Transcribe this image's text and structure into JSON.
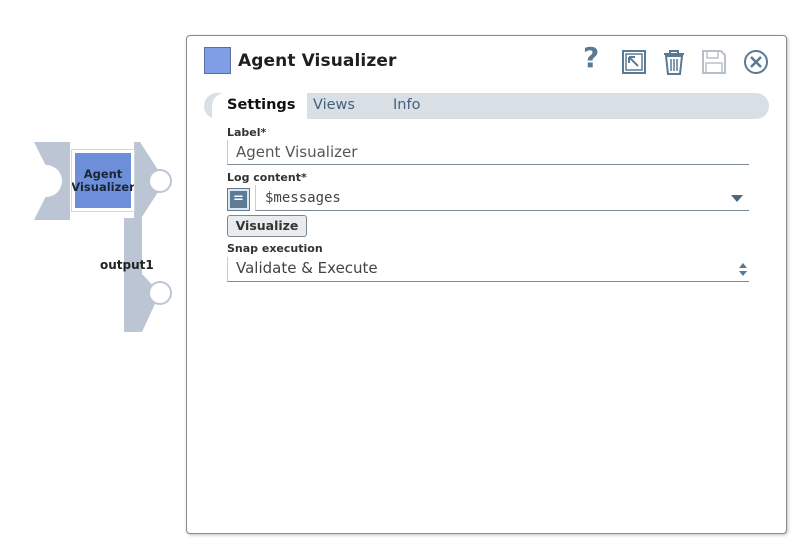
{
  "canvas": {
    "snap_label": "Agent Visualizer",
    "output_view_label": "output1"
  },
  "dialog": {
    "title": "Agent Visualizer",
    "icons": [
      "help-icon",
      "expand-icon",
      "trash-icon",
      "save-icon",
      "close-icon"
    ],
    "help_glyph": "?",
    "tabs": [
      {
        "label": "Settings",
        "active": true
      },
      {
        "label": "Views",
        "active": false
      },
      {
        "label": "Info",
        "active": false
      }
    ],
    "fields": {
      "label": {
        "label": "Label*",
        "value": "Agent Visualizer"
      },
      "log_content": {
        "label": "Log content*",
        "value": "$messages",
        "toggle_glyph": "="
      },
      "visualize_button": "Visualize",
      "snap_execution": {
        "label": "Snap execution",
        "value": "Validate & Execute"
      }
    }
  },
  "colors": {
    "snap_fill": "#6d8fd9",
    "title_swatch": "#7f9ee6",
    "accent": "#5d7a96",
    "tab_bar": "#d8e0e6",
    "connector_gray": "#bcc5d3"
  }
}
